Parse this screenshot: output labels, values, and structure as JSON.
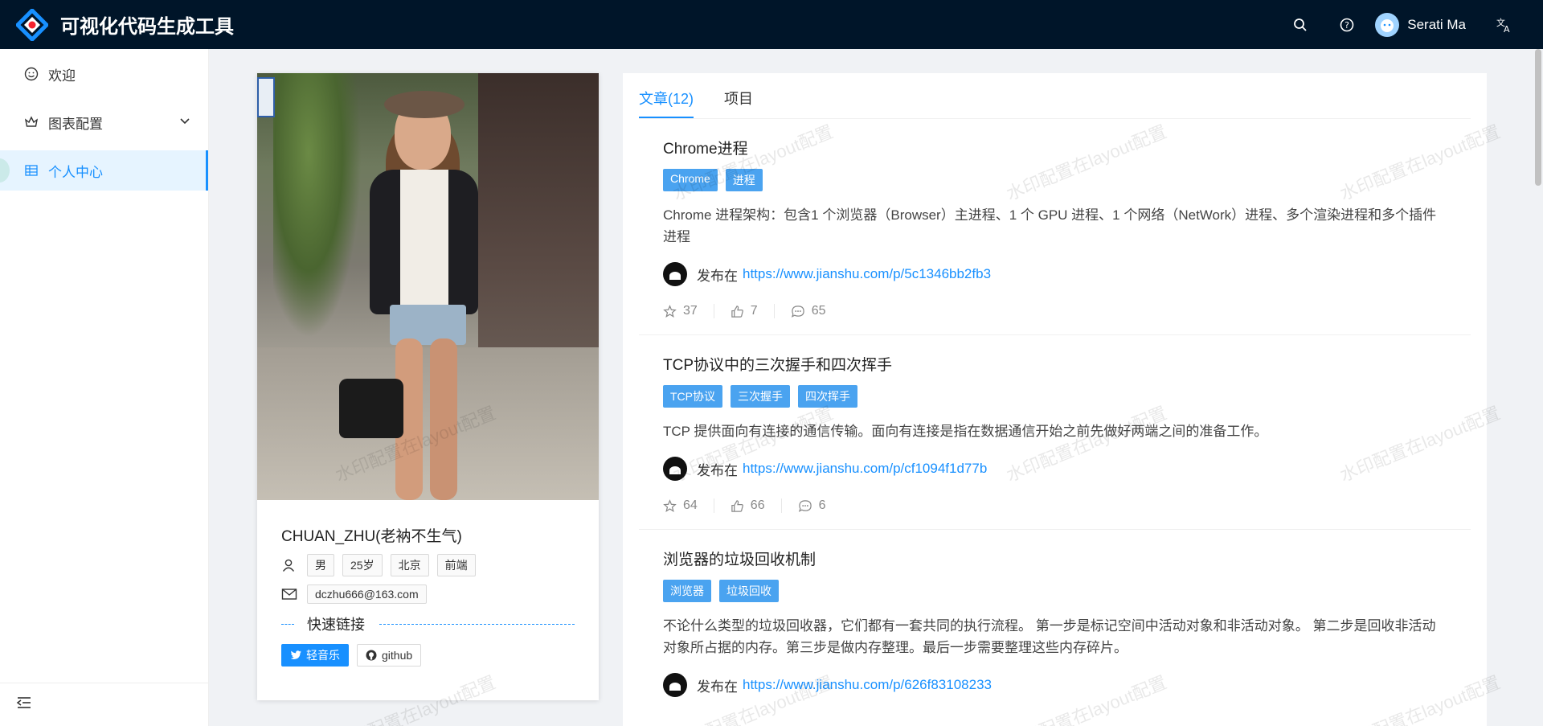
{
  "app": {
    "title": "可视化代码生成工具"
  },
  "header": {
    "user_name": "Serati Ma"
  },
  "sidebar": {
    "items": [
      {
        "label": "欢迎"
      },
      {
        "label": "图表配置"
      },
      {
        "label": "个人中心"
      }
    ]
  },
  "profile": {
    "name": "CHUAN_ZHU(老衲不生气)",
    "tags": [
      "男",
      "25岁",
      "北京",
      "前端"
    ],
    "email": "dczhu666@163.com",
    "quick_links_title": "快速链接",
    "links": [
      {
        "label": "轻音乐"
      },
      {
        "label": "github"
      }
    ]
  },
  "tabs": [
    {
      "label": "文章(12)"
    },
    {
      "label": "项目"
    }
  ],
  "articles": [
    {
      "title": "Chrome进程",
      "tags": [
        "Chrome",
        "进程"
      ],
      "desc": "Chrome 进程架构：包含1 个浏览器（Browser）主进程、1 个 GPU 进程、1 个网络（NetWork）进程、多个渲染进程和多个插件进程",
      "published_label": "发布在",
      "url": "https://www.jianshu.com/p/5c1346bb2fb3",
      "stars": "37",
      "likes": "7",
      "comments": "65"
    },
    {
      "title": "TCP协议中的三次握手和四次挥手",
      "tags": [
        "TCP协议",
        "三次握手",
        "四次挥手"
      ],
      "desc": "TCP 提供面向有连接的通信传输。面向有连接是指在数据通信开始之前先做好两端之间的准备工作。",
      "published_label": "发布在",
      "url": "https://www.jianshu.com/p/cf1094f1d77b",
      "stars": "64",
      "likes": "66",
      "comments": "6"
    },
    {
      "title": "浏览器的垃圾回收机制",
      "tags": [
        "浏览器",
        "垃圾回收"
      ],
      "desc": "不论什么类型的垃圾回收器，它们都有一套共同的执行流程。 第一步是标记空间中活动对象和非活动对象。 第二步是回收非活动对象所占据的内存。第三步是做内存整理。最后一步需要整理这些内存碎片。",
      "published_label": "发布在",
      "url": "https://www.jianshu.com/p/626f83108233"
    }
  ],
  "watermark_text": "水印配置在layout配置",
  "colors": {
    "header_bg": "#001529",
    "primary": "#1890ff",
    "tag_bg": "#4aa3f0",
    "active_menu_bg": "#e6f4ff"
  }
}
